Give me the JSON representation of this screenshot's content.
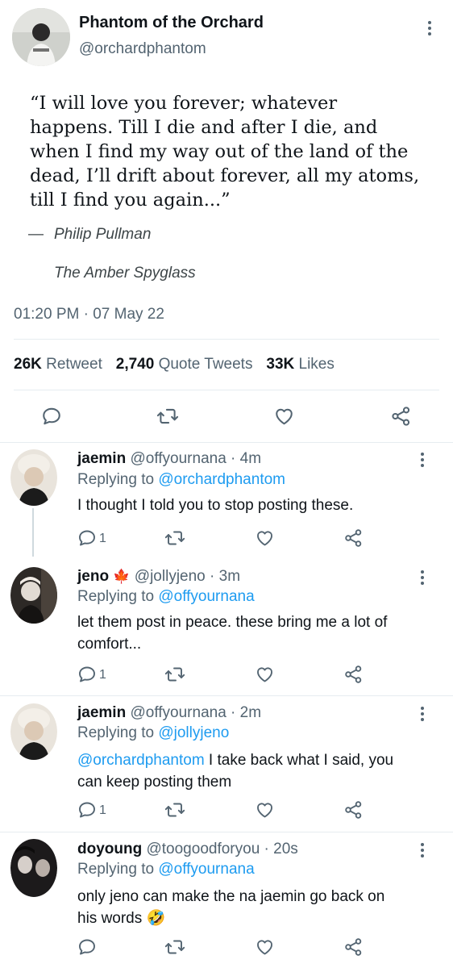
{
  "tweet": {
    "name": "Phantom of the Orchard",
    "handle": "@orchardphantom",
    "quote_lines": [
      "“I will love you forever; whatever",
      "happens. Till I die and after I die, and",
      "when I find my way out of the land of the",
      "dead, I’ll drift about forever, all my atoms,",
      "till I find you again...”"
    ],
    "dash": "—",
    "author": "Philip Pullman",
    "book": "The Amber Spyglass",
    "timestamp": "01:20 PM · 07 May 22",
    "stats": {
      "retweets_count": "26K",
      "retweets_label": "Retweet",
      "quotes_count": "2,740",
      "quotes_label": "Quote Tweets",
      "likes_count": "33K",
      "likes_label": "Likes"
    }
  },
  "replies": [
    {
      "name": "jaemin",
      "badge": "",
      "handle_time": "@offyournana · 4m",
      "replying_prefix": "Replying to ",
      "replying_to": "@orchardphantom",
      "mention": "",
      "body_lines": [
        "I thought I told you to stop posting these."
      ],
      "reply_count": "1"
    },
    {
      "name": "jeno",
      "badge": "🍁",
      "handle_time": "@jollyjeno · 3m",
      "replying_prefix": "Replying to ",
      "replying_to": "@offyournana",
      "mention": "",
      "body_lines": [
        "let them post in peace. these bring me a lot of",
        "comfort..."
      ],
      "reply_count": "1"
    },
    {
      "name": "jaemin",
      "badge": "",
      "handle_time": "@offyournana · 2m",
      "replying_prefix": "Replying to ",
      "replying_to": "@jollyjeno",
      "mention": "@orchardphantom",
      "body_lines": [
        " I take back what I said, you",
        "can keep posting them"
      ],
      "reply_count": "1"
    },
    {
      "name": "doyoung",
      "badge": "",
      "handle_time": "@toogoodforyou · 20s",
      "replying_prefix": "Replying to ",
      "replying_to": "@offyournana",
      "mention": "",
      "body_lines": [
        "only jeno can make the na jaemin go back on",
        "his words 🤣"
      ],
      "reply_count": ""
    }
  ],
  "icons": {
    "reply": "reply-icon",
    "retweet": "retweet-icon",
    "like": "heart-icon",
    "share": "share-icon",
    "more": "more-vertical-icon"
  },
  "colors": {
    "link": "#1d9bf0",
    "muted": "#536471",
    "text": "#0f1419"
  }
}
